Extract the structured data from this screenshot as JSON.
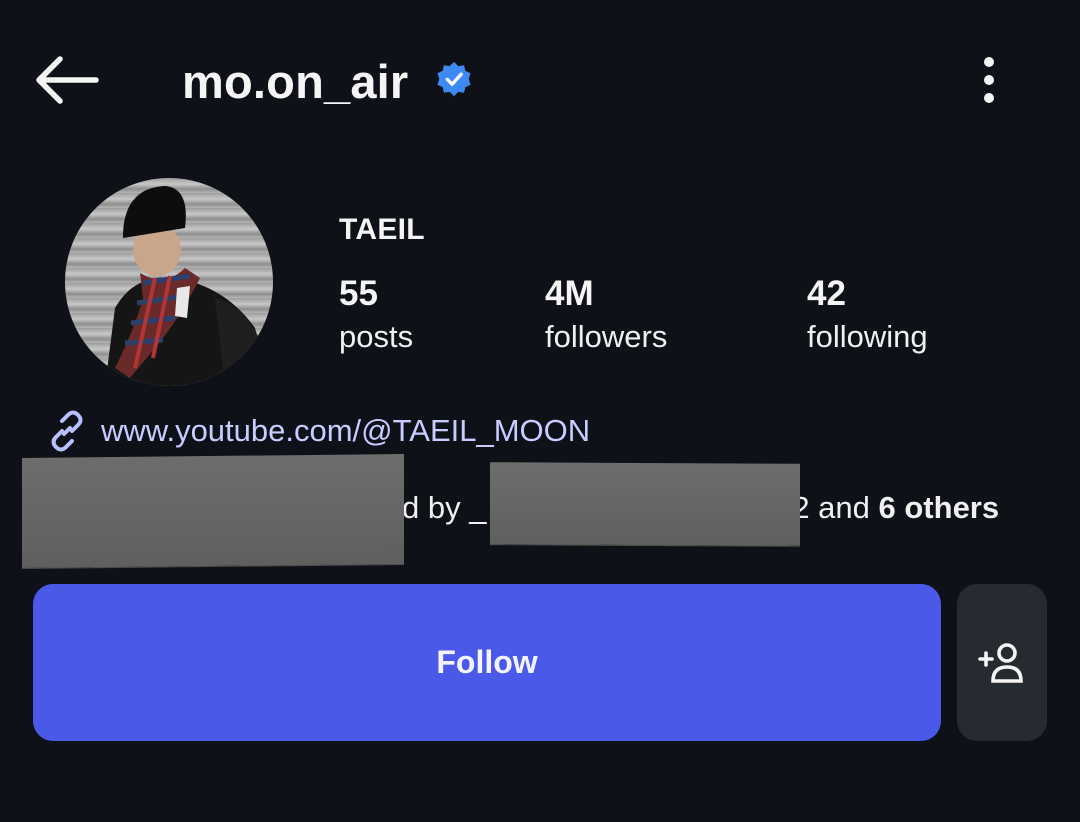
{
  "header": {
    "username": "mo.on_air",
    "verified_icon": "verified-badge-icon",
    "back_icon": "arrow-left-icon",
    "more_icon": "more-vertical-icon"
  },
  "profile": {
    "display_name": "TAEIL",
    "stats": [
      {
        "value": "55",
        "label": "posts"
      },
      {
        "value": "4M",
        "label": "followers"
      },
      {
        "value": "42",
        "label": "following"
      }
    ],
    "link": {
      "icon": "link-icon",
      "text": "www.youtube.com/@TAEIL_MOON"
    },
    "followed_by": {
      "prefix_visible": "d by _",
      "suffix_visible": ")2 and ",
      "others": "6 others"
    }
  },
  "actions": {
    "follow_label": "Follow",
    "add_person_icon": "add-person-icon"
  },
  "colors": {
    "background": "#0e1117",
    "accent": "#4b59e8",
    "verified": "#3d8bf2",
    "link": "#c8ccff"
  }
}
